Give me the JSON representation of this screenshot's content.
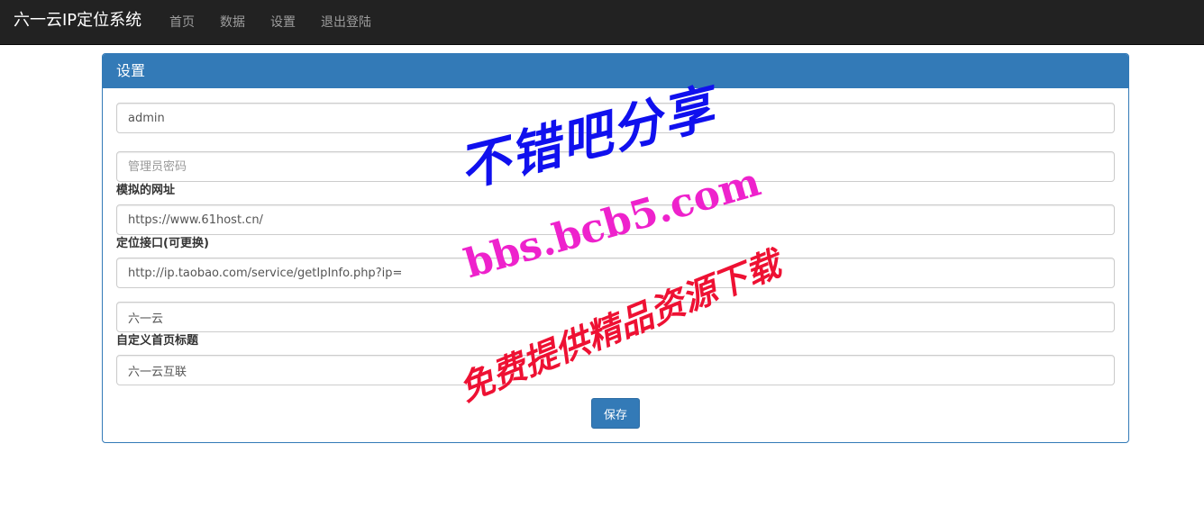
{
  "navbar": {
    "brand": "六一云IP定位系统",
    "items": [
      {
        "label": "首页"
      },
      {
        "label": "数据"
      },
      {
        "label": "设置"
      },
      {
        "label": "退出登陆"
      }
    ]
  },
  "panel": {
    "title": "设置",
    "fields": {
      "username": {
        "value": "admin",
        "placeholder": ""
      },
      "password": {
        "value": "",
        "placeholder": "管理员密码"
      },
      "mock_url": {
        "label": "模拟的网址",
        "value": "https://www.61host.cn/"
      },
      "locate_api": {
        "label": "定位接口(可更换)",
        "value": "http://ip.taobao.com/service/getIpInfo.php?ip="
      },
      "site_name": {
        "value": "六一云"
      },
      "home_title": {
        "label": "自定义首页标题",
        "value": "六一云互联"
      }
    },
    "save_label": "保存"
  },
  "watermark": {
    "line1": "不错吧分享",
    "line2": "bbs.bcb5.com",
    "line3": "免费提供精品资源下载"
  },
  "colors": {
    "navbar_bg": "#222222",
    "primary": "#337ab7",
    "watermark_blue": "#1010ee",
    "watermark_pink": "#ee22cc",
    "watermark_red": "#ee1133"
  }
}
